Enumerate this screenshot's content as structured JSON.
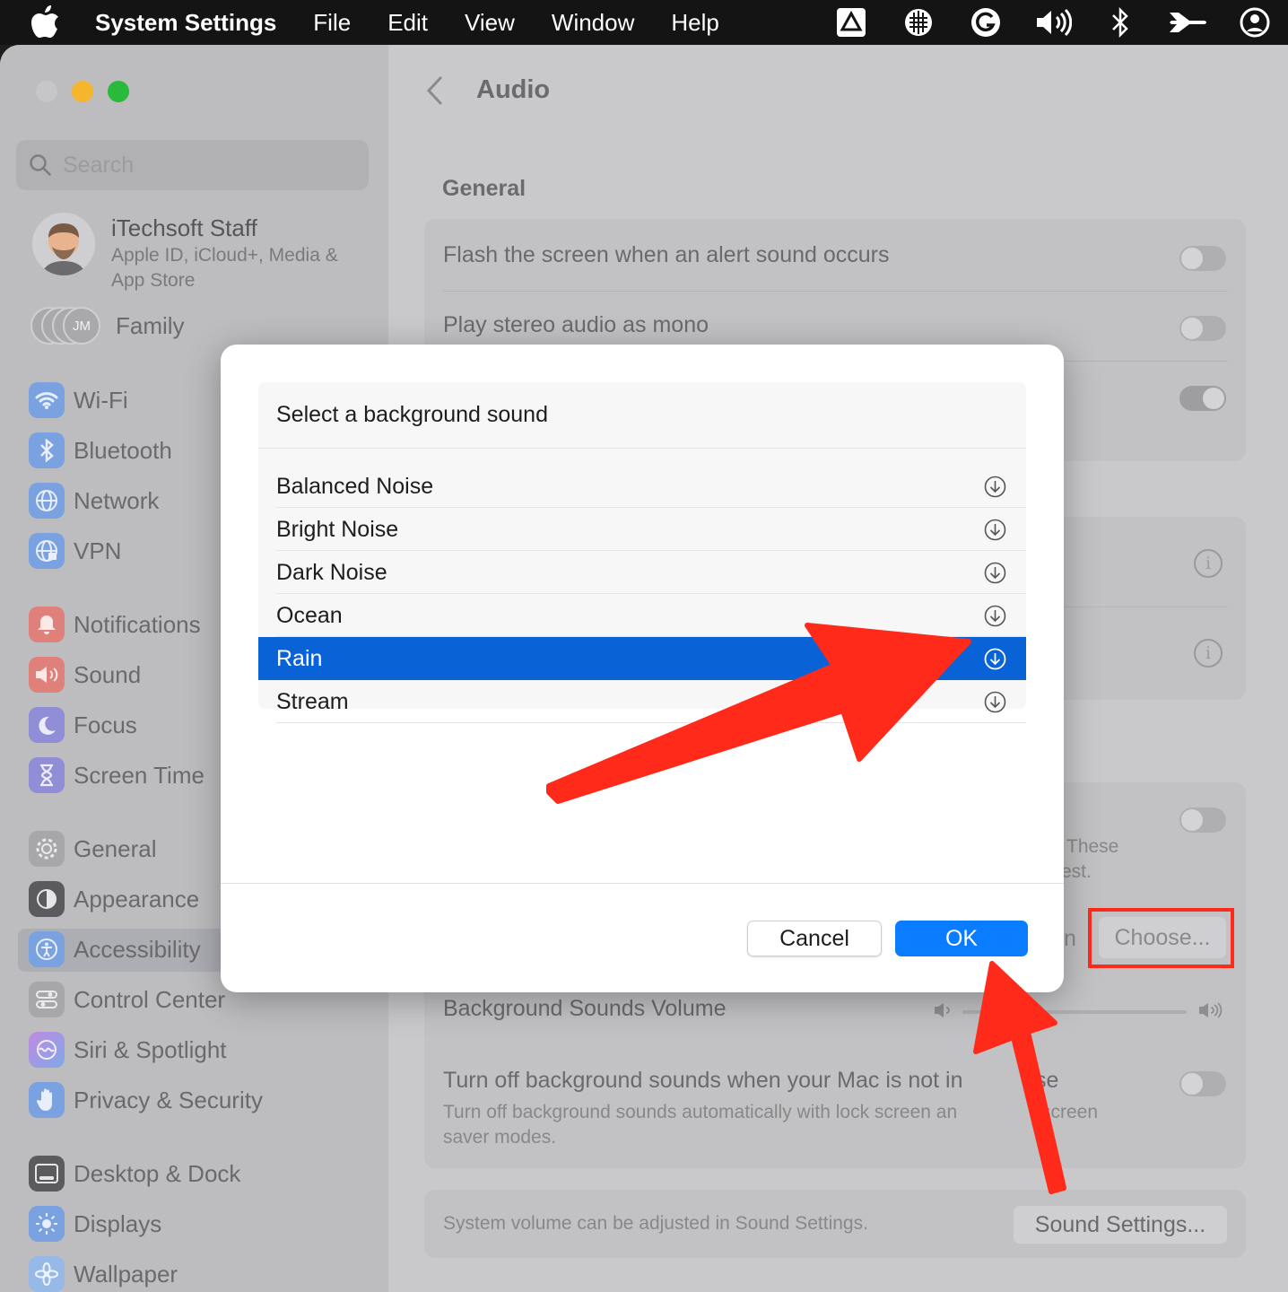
{
  "menubar": {
    "app_name": "System Settings",
    "menus": [
      "File",
      "Edit",
      "View",
      "Window",
      "Help"
    ]
  },
  "sidebar": {
    "search_placeholder": "Search",
    "account": {
      "name": "iTechsoft Staff",
      "subtitle": "Apple ID, iCloud+, Media & App Store"
    },
    "family": {
      "label": "Family",
      "initials": "JM"
    },
    "items": [
      {
        "label": "Wi-Fi",
        "icon": "wifi-icon",
        "color": "#3b82f6"
      },
      {
        "label": "Bluetooth",
        "icon": "bluetooth-icon",
        "color": "#3b82f6"
      },
      {
        "label": "Network",
        "icon": "globe-icon",
        "color": "#3b82f6"
      },
      {
        "label": "VPN",
        "icon": "vpn-globe-icon",
        "color": "#3b82f6"
      },
      {
        "label": "Notifications",
        "icon": "bell-icon",
        "color": "#ef4444"
      },
      {
        "label": "Sound",
        "icon": "speaker-icon",
        "color": "#ef4444"
      },
      {
        "label": "Focus",
        "icon": "moon-icon",
        "color": "#6366f1"
      },
      {
        "label": "Screen Time",
        "icon": "hourglass-icon",
        "color": "#6366f1"
      },
      {
        "label": "General",
        "icon": "gear-icon",
        "color": "#8e8e93"
      },
      {
        "label": "Appearance",
        "icon": "appearance-icon",
        "color": "#1c1c1e"
      },
      {
        "label": "Accessibility",
        "icon": "accessibility-icon",
        "color": "#3b82f6"
      },
      {
        "label": "Control Center",
        "icon": "control-center-icon",
        "color": "#8e8e93"
      },
      {
        "label": "Siri & Spotlight",
        "icon": "siri-icon",
        "color": "#a855f7"
      },
      {
        "label": "Privacy & Security",
        "icon": "hand-icon",
        "color": "#3b82f6"
      },
      {
        "label": "Desktop & Dock",
        "icon": "dock-icon",
        "color": "#1c1c1e"
      },
      {
        "label": "Displays",
        "icon": "sun-icon",
        "color": "#3b82f6"
      },
      {
        "label": "Wallpaper",
        "icon": "wallpaper-icon",
        "color": "#60a5fa"
      }
    ],
    "selected_item": "Accessibility"
  },
  "main": {
    "title": "Audio",
    "section": "General",
    "rows": {
      "flash_screen": "Flash the screen when an alert sound occurs",
      "mono_audio": "Play stereo audio as mono",
      "hint_fragment_1": "These",
      "hint_fragment_2": "est.",
      "choose_prefix": "n",
      "choose_button": "Choose...",
      "bg_volume": "Background Sounds Volume",
      "turn_off_title_a": "Turn off background sounds when your Mac is not in",
      "turn_off_title_b": "se",
      "turn_off_sub_a": "Turn off background sounds automatically with lock screen an",
      "turn_off_sub_b": "screen",
      "turn_off_sub_c": "saver modes.",
      "system_volume_note": "System volume can be adjusted in Sound Settings.",
      "sound_settings_button": "Sound Settings..."
    }
  },
  "dialog": {
    "header": "Select a background sound",
    "sounds": [
      "Balanced Noise",
      "Bright Noise",
      "Dark Noise",
      "Ocean",
      "Rain",
      "Stream"
    ],
    "selected": "Rain",
    "cancel_label": "Cancel",
    "ok_label": "OK"
  },
  "colors": {
    "selection_blue": "#0a63d6",
    "ok_blue": "#0a7cff",
    "annotation_red": "#ff2a1a"
  }
}
